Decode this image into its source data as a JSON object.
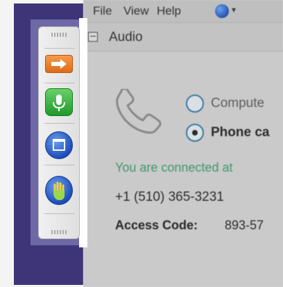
{
  "menu": {
    "file": "File",
    "view": "View",
    "help": "Help"
  },
  "audio": {
    "collapse_symbol": "−",
    "title": "Audio",
    "options": {
      "computer": "Compute",
      "phone": "Phone ca"
    },
    "selected_option": "phone",
    "connected_text": "You are connected at",
    "phone_number": "+1 (510) 365-3231",
    "access_code_label": "Access Code:",
    "access_code_value": "893-57"
  },
  "toolbar": {
    "buttons": [
      {
        "name": "share",
        "icon": "arrow-right-icon",
        "color": "#e8792a"
      },
      {
        "name": "microphone",
        "icon": "microphone-icon",
        "color": "#2aa336"
      },
      {
        "name": "window",
        "icon": "window-icon",
        "color": "#2457c5"
      },
      {
        "name": "raise-hand",
        "icon": "hand-icon",
        "color": "#2457c5"
      }
    ]
  },
  "colors": {
    "desktop": "#3d3577",
    "connected_text": "#3a9c6e",
    "radio_border": "#2f7aa8"
  }
}
